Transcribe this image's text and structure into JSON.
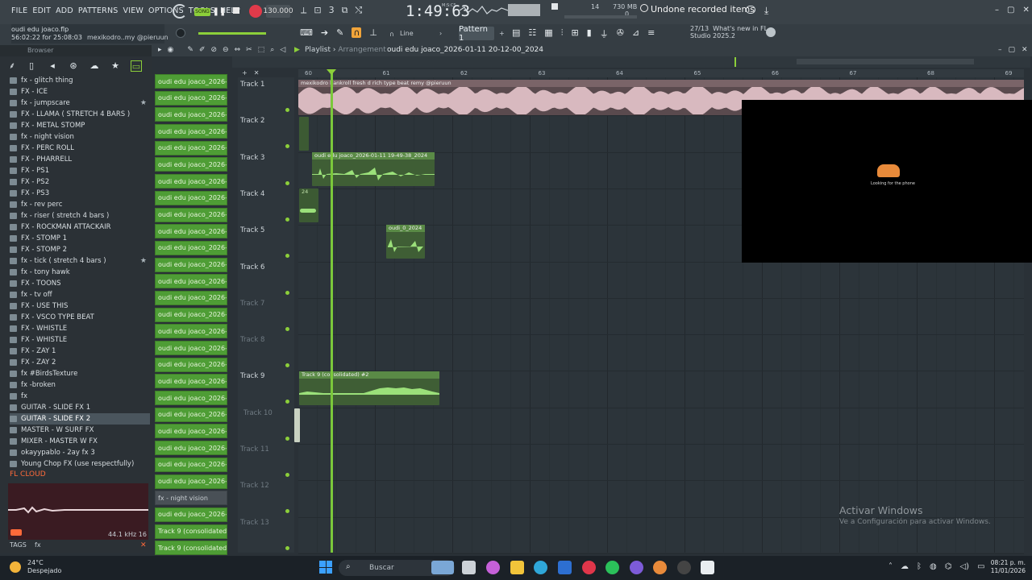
{
  "menu": [
    "FILE",
    "EDIT",
    "ADD",
    "PATTERNS",
    "VIEW",
    "OPTIONS",
    "TOOLS",
    "HELP"
  ],
  "transport": {
    "song_mode": "SONG",
    "tempo": "130.000",
    "time": "1:49:63",
    "time_unit": "M:S:CS",
    "cpu": "14",
    "memory": "730 MB",
    "memory_sub": "0",
    "hint": "Undone recorded items"
  },
  "project": {
    "file": "oudi edu joaco.flp",
    "elapsed": "56:02:22 for 25:08:03",
    "author": "mexikodro..my @pieruun"
  },
  "toolbar2": {
    "snap": "Line",
    "pattern": "Pattern 1",
    "news_count": "27/13",
    "news_title": "What's new in FL",
    "news_sub": "Studio 2025.2"
  },
  "browser": {
    "title": "Browser",
    "items": [
      {
        "label": "fx - glitch thing",
        "star": false,
        "selected": false
      },
      {
        "label": "FX - ICE",
        "star": false,
        "selected": false
      },
      {
        "label": "fx - jumpscare",
        "star": true,
        "selected": false
      },
      {
        "label": "FX - LLAMA ( STRETCH 4 BARS )",
        "star": false,
        "selected": false
      },
      {
        "label": "FX - METAL STOMP",
        "star": false,
        "selected": false
      },
      {
        "label": "fx - night vision",
        "star": false,
        "selected": false
      },
      {
        "label": "FX - PERC ROLL",
        "star": false,
        "selected": false
      },
      {
        "label": "FX - PHARRELL",
        "star": false,
        "selected": false
      },
      {
        "label": "FX - PS1",
        "star": false,
        "selected": false
      },
      {
        "label": "FX - PS2",
        "star": false,
        "selected": false
      },
      {
        "label": "FX - PS3",
        "star": false,
        "selected": false
      },
      {
        "label": "fx - rev perc",
        "star": false,
        "selected": false
      },
      {
        "label": "fx - riser ( stretch 4 bars )",
        "star": false,
        "selected": false
      },
      {
        "label": "FX - ROCKMAN ATTACKAIR",
        "star": false,
        "selected": false
      },
      {
        "label": "FX - STOMP 1",
        "star": false,
        "selected": false
      },
      {
        "label": "FX - STOMP 2",
        "star": false,
        "selected": false
      },
      {
        "label": "fx - tick ( stretch 4 bars )",
        "star": true,
        "selected": false
      },
      {
        "label": "fx - tony hawk",
        "star": false,
        "selected": false
      },
      {
        "label": "FX - TOONS",
        "star": false,
        "selected": false
      },
      {
        "label": "fx - tv off",
        "star": false,
        "selected": false
      },
      {
        "label": "FX - USE THIS",
        "star": false,
        "selected": false
      },
      {
        "label": "FX - VSCO TYPE BEAT",
        "star": false,
        "selected": false
      },
      {
        "label": "FX - WHISTLE",
        "star": false,
        "selected": false
      },
      {
        "label": "FX - WHISTLE",
        "star": false,
        "selected": false
      },
      {
        "label": "FX - ZAY 1",
        "star": false,
        "selected": false
      },
      {
        "label": "FX - ZAY 2",
        "star": false,
        "selected": false
      },
      {
        "label": "fx #BirdsTexture",
        "star": false,
        "selected": false
      },
      {
        "label": "fx -broken",
        "star": false,
        "selected": false
      },
      {
        "label": "fx",
        "star": false,
        "selected": false
      },
      {
        "label": "GUITAR - SLIDE FX 1",
        "star": false,
        "selected": false
      },
      {
        "label": "GUITAR - SLIDE FX 2",
        "star": false,
        "selected": true
      },
      {
        "label": "MASTER - W SURF FX",
        "star": false,
        "selected": false
      },
      {
        "label": "MIXER - MASTER W FX",
        "star": false,
        "selected": false
      },
      {
        "label": "okayypablo - 2ay fx 3",
        "star": false,
        "selected": false
      },
      {
        "label": "Young Chop FX (use respectfully)",
        "star": false,
        "selected": false
      }
    ],
    "cloud": "FL CLOUD",
    "preview_rate": "44.1 kHz 16",
    "tags_label": "TAGS",
    "tags_value": "fx"
  },
  "channels": [
    "oudi edu joaco_2026-01...",
    "oudi edu joaco_2026-01...",
    "oudi edu joaco_2026-01...",
    "oudi edu joaco_2026-01...",
    "oudi edu joaco_2026-01...",
    "oudi edu joaco_2026-01...",
    "oudi edu joaco_2026-01...",
    "oudi edu joaco_2026-01...",
    "oudi edu joaco_2026-01...",
    "oudi edu joaco_2026-01...",
    "oudi edu joaco_2026-01...",
    "oudi edu joaco_2026-01...",
    "oudi edu joaco_2026-01...",
    "oudi edu joaco_2026-01...",
    "oudi edu joaco_2026-01...",
    "oudi edu joaco_2026-01...",
    "oudi edu joaco_2026-01...",
    "oudi edu joaco_2026-01...",
    "oudi edu joaco_2026-01...",
    "oudi edu joaco_2026-01...",
    "oudi edu joaco_2026-01...",
    "oudi edu joaco_2026-01...",
    "oudi edu joaco_2026-01...",
    "oudi edu joaco_2026-01...",
    "oudi edu joaco_2026-01...",
    "fx - night vision",
    "oudi edu joaco_2026-01...",
    "Track 9 (consolidated)",
    "Track 9 (consolidated..."
  ],
  "playlist": {
    "title": "Playlist",
    "mode": "Arrangement",
    "name": "oudi edu joaco_2026-01-11 20-12-00_2024",
    "ruler": [
      "60",
      "61",
      "62",
      "63",
      "64",
      "65",
      "66",
      "67",
      "68",
      "69"
    ],
    "tracks": [
      "Track 1",
      "Track 2",
      "Track 3",
      "Track 4",
      "Track 5",
      "Track 6",
      "Track 7",
      "Track 8",
      "Track 9",
      "Track 10",
      "Track 11",
      "Track 12",
      "Track 13"
    ],
    "clips": {
      "track1": "mexikodro  bankroll fresh  d rich type beat remy @pieruun",
      "track3": "oudi edu joaco_2026-01-11 19-49-38_2024",
      "track4": "24",
      "track5": "oudi_0_2024",
      "track9": "Track 9 (consolidated) #2"
    }
  },
  "overlay_text": "Looking for the phone",
  "watermark": {
    "title": "Activar Windows",
    "sub": "Ve a Configuración para activar Windows."
  },
  "taskbar": {
    "weather_temp": "24°C",
    "weather_desc": "Despejado",
    "search": "Buscar",
    "time": "08:21 p. m.",
    "date": "11/01/2026"
  },
  "colors": {
    "accent_green": "#8ccf3a",
    "record_red": "#e03a4a",
    "clip_pink": "#d8b9bf",
    "channel_green": "#4e9d35"
  }
}
